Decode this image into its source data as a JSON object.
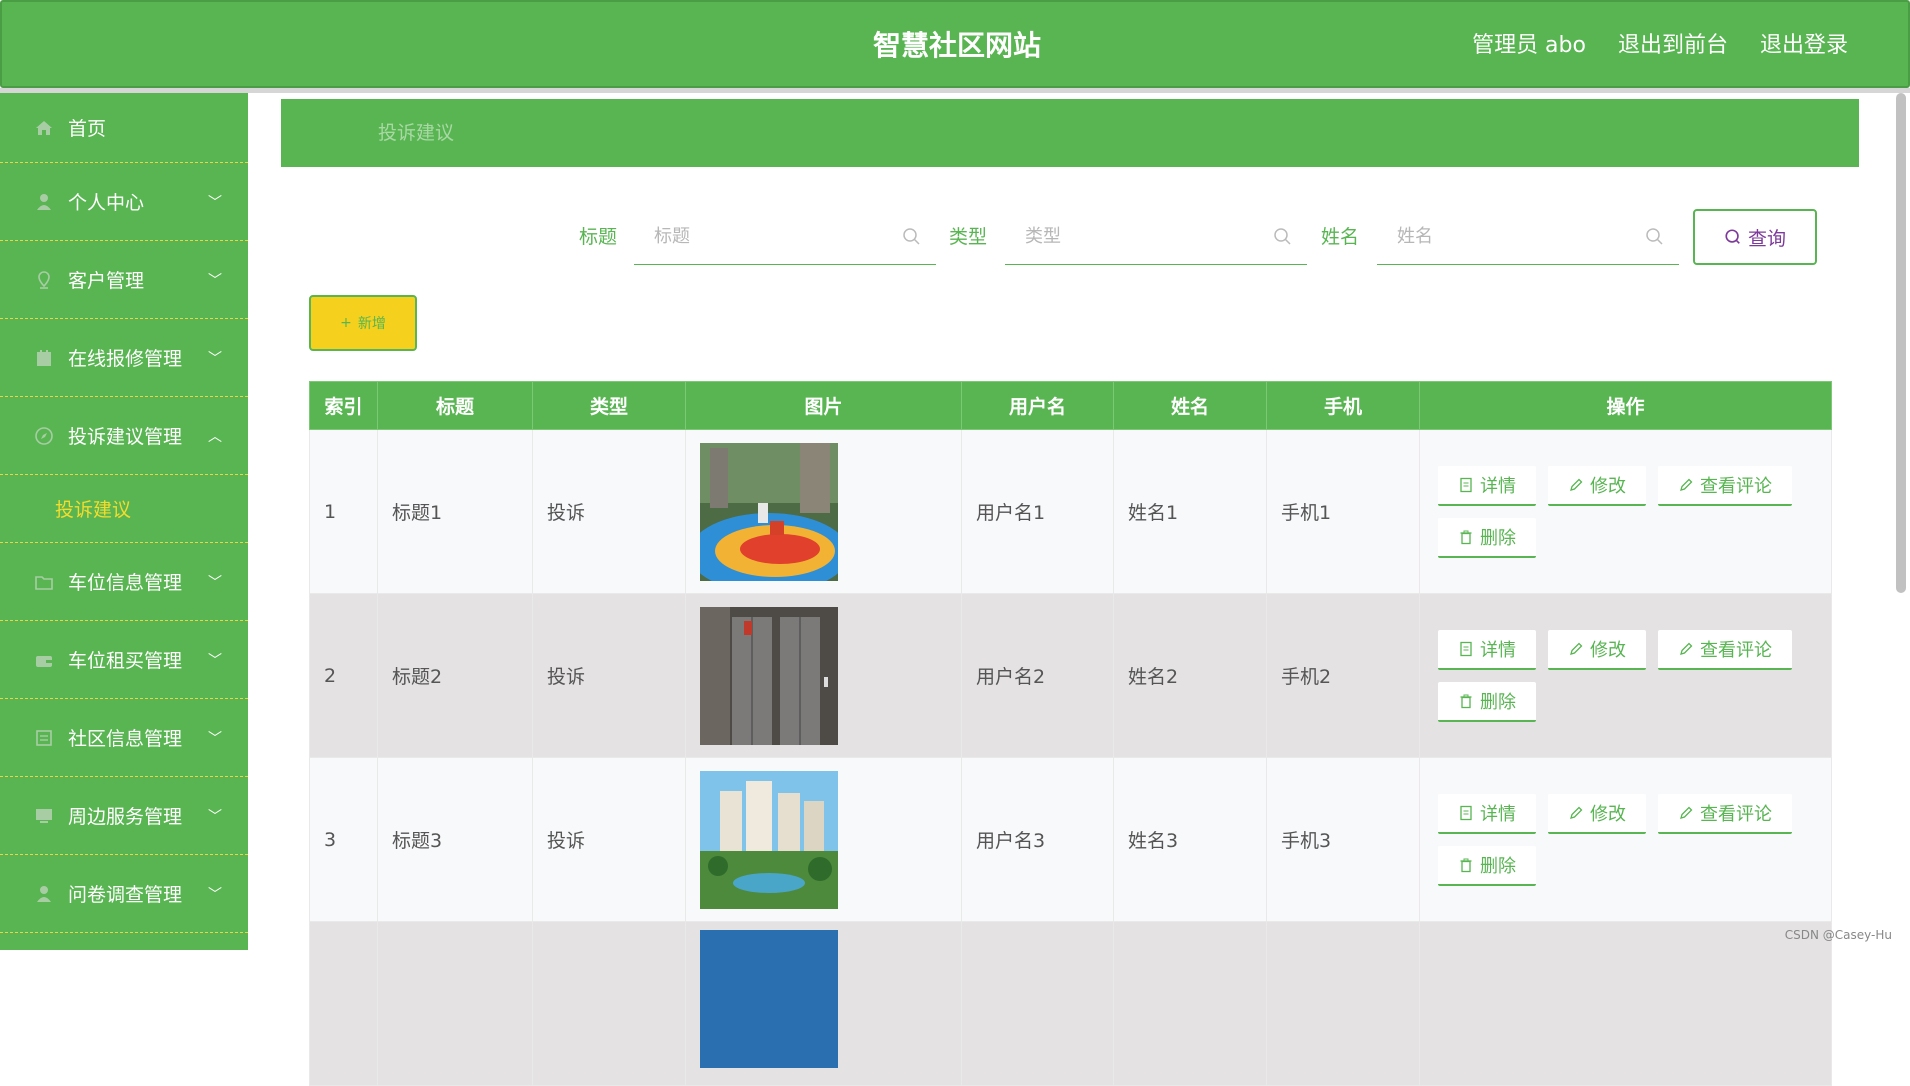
{
  "header": {
    "title": "智慧社区网站",
    "admin": "管理员 abo",
    "to_front": "退出到前台",
    "logout": "退出登录"
  },
  "sidebar": {
    "home": "首页",
    "items": [
      {
        "label": "个人中心",
        "icon": "user-icon"
      },
      {
        "label": "客户管理",
        "icon": "location-icon"
      },
      {
        "label": "在线报修管理",
        "icon": "calendar-icon"
      },
      {
        "label": "投诉建议管理",
        "icon": "compass-icon",
        "expanded": true
      },
      {
        "label": "车位信息管理",
        "icon": "folder-icon"
      },
      {
        "label": "车位租买管理",
        "icon": "wallet-icon"
      },
      {
        "label": "社区信息管理",
        "icon": "document-icon"
      },
      {
        "label": "周边服务管理",
        "icon": "monitor-icon"
      },
      {
        "label": "问卷调查管理",
        "icon": "user-icon"
      }
    ],
    "active_sub": "投诉建议"
  },
  "breadcrumb": "投诉建议",
  "search": {
    "title_label": "标题",
    "title_placeholder": "标题",
    "type_label": "类型",
    "type_placeholder": "类型",
    "name_label": "姓名",
    "name_placeholder": "姓名",
    "query": "查询"
  },
  "add_label": "新增",
  "table": {
    "headers": [
      "索引",
      "标题",
      "类型",
      "图片",
      "用户名",
      "姓名",
      "手机",
      "操作"
    ],
    "rows": [
      {
        "index": "1",
        "title": "标题1",
        "type": "投诉",
        "username": "用户名1",
        "name": "姓名1",
        "phone": "手机1"
      },
      {
        "index": "2",
        "title": "标题2",
        "type": "投诉",
        "username": "用户名2",
        "name": "姓名2",
        "phone": "手机2"
      },
      {
        "index": "3",
        "title": "标题3",
        "type": "投诉",
        "username": "用户名3",
        "name": "姓名3",
        "phone": "手机3"
      }
    ],
    "actions": {
      "detail": "详情",
      "edit": "修改",
      "comments": "查看评论",
      "delete": "删除"
    }
  },
  "watermark": "CSDN @Casey-Hu",
  "colors": {
    "primary": "#58b552",
    "accent_yellow": "#f5d11e",
    "sub_active": "#f3dc2d"
  }
}
